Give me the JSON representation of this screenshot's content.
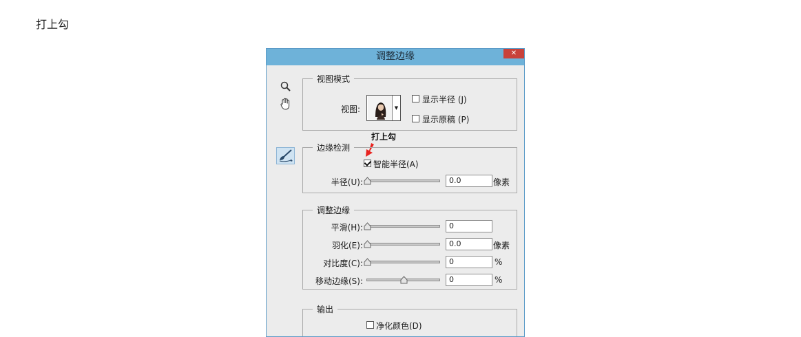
{
  "page": {
    "caption": "打上勾"
  },
  "dialog": {
    "title": "调整边缘",
    "close_glyph": "✕",
    "view_mode": {
      "legend": "视图模式",
      "view_label": "视图:",
      "show_radius": {
        "label": "显示半径 (J)",
        "checked": false
      },
      "show_original": {
        "label": "显示原稿 (P)",
        "checked": false
      }
    },
    "annotation": {
      "text": "打上勾",
      "arrow_color": "#e8231f"
    },
    "edge_detection": {
      "legend": "边缘检测",
      "smart_radius": {
        "label": "智能半径(A)",
        "checked": true
      },
      "radius": {
        "label": "半径(U):",
        "value": "0.0",
        "unit": "像素",
        "slider_fraction": 0
      }
    },
    "adjust_edge": {
      "legend": "调整边缘",
      "rows": [
        {
          "label": "平滑(H):",
          "value": "0",
          "unit": "",
          "slider_fraction": 0
        },
        {
          "label": "羽化(E):",
          "value": "0.0",
          "unit": "像素",
          "slider_fraction": 0
        },
        {
          "label": "对比度(C):",
          "value": "0",
          "unit": "%",
          "slider_fraction": 0
        },
        {
          "label": "移动边缘(S):",
          "value": "0",
          "unit": "%",
          "slider_fraction": 0.5
        }
      ]
    },
    "output": {
      "legend": "输出",
      "decontaminate": {
        "label": "净化颜色(D)",
        "checked": false
      }
    },
    "tools": [
      "zoom-icon",
      "hand-icon",
      "refine-radius-brush-icon"
    ],
    "colors": {
      "titlebar": "#6eb2d9",
      "close": "#c9413a",
      "panel": "#ececec"
    }
  }
}
